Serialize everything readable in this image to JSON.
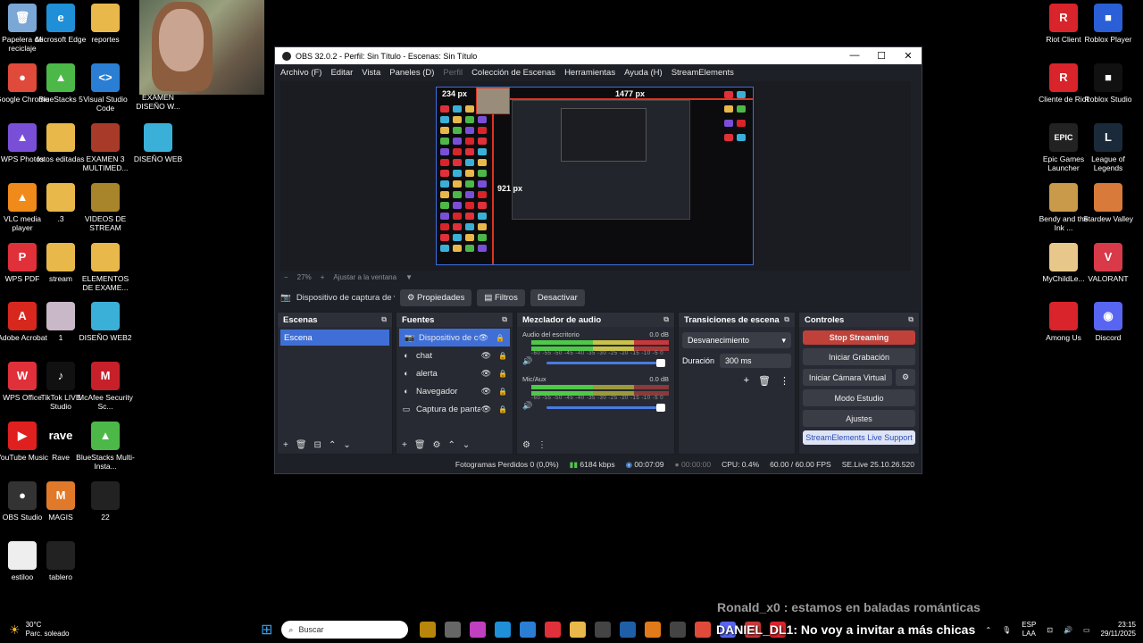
{
  "desktop_left": [
    {
      "label": "Papelera de reciclaje",
      "color": "#7aa7d6",
      "glyph": "🗑"
    },
    {
      "label": "Microsoft Edge",
      "color": "#1f8fd8",
      "glyph": "e"
    },
    {
      "label": "reportes",
      "color": "#e8b84a",
      "glyph": ""
    },
    {
      "label": "Google Chrome",
      "color": "#e04a3a",
      "glyph": "●"
    },
    {
      "label": "BlueStacks 5",
      "color": "#4cb848",
      "glyph": "▲"
    },
    {
      "label": "Visual Studio Code",
      "color": "#2a7fd4",
      "glyph": "<>"
    },
    {
      "label": "EXAMEN DISEÑO W...",
      "color": "#e8b84a",
      "glyph": ""
    },
    {
      "label": "WPS Photos",
      "color": "#7a4fd8",
      "glyph": "▲"
    },
    {
      "label": "fotos editadas",
      "color": "#e8b84a",
      "glyph": ""
    },
    {
      "label": "EXAMEN 3 MULTIMED...",
      "color": "#a83a2a",
      "glyph": ""
    },
    {
      "label": "DISEÑO WEB",
      "color": "#3ab0d8",
      "glyph": ""
    },
    {
      "label": "VLC media player",
      "color": "#f08a1a",
      "glyph": "▲"
    },
    {
      "label": ".3",
      "color": "#e8b84a",
      "glyph": ""
    },
    {
      "label": "VIDEOS DE STREAM",
      "color": "#a8842a",
      "glyph": ""
    },
    {
      "label": "WPS PDF",
      "color": "#e0303a",
      "glyph": "P"
    },
    {
      "label": "stream",
      "color": "#e8b84a",
      "glyph": ""
    },
    {
      "label": "ELEMENTOS DE EXAME...",
      "color": "#e8b84a",
      "glyph": ""
    },
    {
      "label": "Adobe Acrobat",
      "color": "#d8281e",
      "glyph": "A"
    },
    {
      "label": "1",
      "color": "#c8b8c8",
      "glyph": ""
    },
    {
      "label": "DISEÑO WEB2",
      "color": "#3ab0d8",
      "glyph": ""
    },
    {
      "label": "WPS Office",
      "color": "#e0303a",
      "glyph": "W"
    },
    {
      "label": "TikTok LIVE Studio",
      "color": "#111",
      "glyph": "♪"
    },
    {
      "label": "McAfee Security Sc...",
      "color": "#c8202a",
      "glyph": "M"
    },
    {
      "label": "YouTube Music",
      "color": "#e0201e",
      "glyph": "▶"
    },
    {
      "label": "Rave",
      "color": "#000",
      "glyph": "rave"
    },
    {
      "label": "BlueStacks Multi-Insta...",
      "color": "#4cb848",
      "glyph": "▲"
    },
    {
      "label": "OBS Studio",
      "color": "#333",
      "glyph": "●"
    },
    {
      "label": "MAGIS",
      "color": "#e07a2a",
      "glyph": "M"
    },
    {
      "label": "22",
      "color": "#222",
      "glyph": ""
    },
    {
      "label": "estiloo",
      "color": "#eee",
      "glyph": ""
    },
    {
      "label": "tablero",
      "color": "#222",
      "glyph": ""
    }
  ],
  "desktop_right": [
    {
      "label": "Riot Client",
      "color": "#d8242a",
      "glyph": "R"
    },
    {
      "label": "Roblox Player",
      "color": "#2a5fd8",
      "glyph": "■"
    },
    {
      "label": "Cliente de Riot",
      "color": "#d8242a",
      "glyph": "R"
    },
    {
      "label": "Roblox Studio",
      "color": "#111",
      "glyph": "■"
    },
    {
      "label": "Epic Games Launcher",
      "color": "#222",
      "glyph": "EPIC"
    },
    {
      "label": "League of Legends",
      "color": "#1a2a3a",
      "glyph": "L"
    },
    {
      "label": "Bendy and the Ink ...",
      "color": "#c89a4a",
      "glyph": ""
    },
    {
      "label": "Stardew Valley",
      "color": "#d87a3a",
      "glyph": ""
    },
    {
      "label": "MyChildLe...",
      "color": "#e8c88a",
      "glyph": ""
    },
    {
      "label": "VALORANT",
      "color": "#d83a4a",
      "glyph": "V"
    },
    {
      "label": "Among Us",
      "color": "#d8242a",
      "glyph": ""
    },
    {
      "label": "Discord",
      "color": "#5865f2",
      "glyph": "◉"
    }
  ],
  "obs": {
    "title": "OBS 32.0.2 - Perfil: Sin Título - Escenas: Sin Título",
    "menu": [
      "Archivo (F)",
      "Editar",
      "Vista",
      "Paneles (D)",
      "Perfil",
      "Colección de Escenas",
      "Herramientas",
      "Ayuda (H)",
      "StreamElements"
    ],
    "preview": {
      "px_top": "234 px",
      "px_width": "1477 px",
      "px_height": "921 px"
    },
    "zoom": {
      "minus": "−",
      "value": "27%",
      "plus": "+",
      "fit": "Ajustar a la ventana"
    },
    "sourcebar": {
      "name": "Dispositivo de captura de v",
      "properties": "Propiedades",
      "filters": "Filtros",
      "deactivate": "Desactivar"
    },
    "scenes": {
      "header": "Escenas",
      "items": [
        "Escena"
      ]
    },
    "sources": {
      "header": "Fuentes",
      "items": [
        {
          "name": "Dispositivo de cap",
          "icon": "📷",
          "selected": true
        },
        {
          "name": "chat",
          "icon": "◐",
          "selected": false
        },
        {
          "name": "alerta",
          "icon": "◐",
          "selected": false
        },
        {
          "name": "Navegador",
          "icon": "◐",
          "selected": false
        },
        {
          "name": "Captura de panta",
          "icon": "▭",
          "selected": false
        }
      ]
    },
    "mixer": {
      "header": "Mezclador de audio",
      "channels": [
        {
          "name": "Audio del escritorio",
          "db": "0.0 dB"
        },
        {
          "name": "Mic/Aux",
          "db": "0.0 dB"
        }
      ],
      "scale": "-60 -55 -50 -45 -40 -35 -30 -25 -20 -15 -10 -5 0"
    },
    "transitions": {
      "header": "Transiciones de escena",
      "selected": "Desvanecimiento",
      "duration_label": "Duración",
      "duration_value": "300 ms"
    },
    "controls": {
      "header": "Controles",
      "stop_streaming": "Stop Streaming",
      "start_recording": "Iniciar Grabación",
      "virtual_camera": "Iniciar Cámara Virtual",
      "studio_mode": "Modo Estudio",
      "settings": "Ajustes",
      "se_support": "StreamElements Live Support"
    },
    "status": {
      "dropped": "Fotogramas Perdidos 0 (0,0%)",
      "bitrate": "6184 kbps",
      "stream_time": "00:07:09",
      "rec_time": "00:00:00",
      "cpu": "CPU: 0.4%",
      "fps": "60.00 / 60.00 FPS",
      "se": "SE.Live 25.10.26.520"
    }
  },
  "overlay": {
    "chat1": "Ronald_x0 : estamos en baladas románticas",
    "chat2_user": "DANIEL_DL1",
    "chat2_msg": ": No voy a invitar a más chicas"
  },
  "taskbar": {
    "weather_temp": "30°C",
    "weather_desc": "Parc. soleado",
    "search_placeholder": "Buscar",
    "lang": "ESP",
    "lang2": "LAA",
    "time": "23:15",
    "date": "29/11/2025"
  }
}
